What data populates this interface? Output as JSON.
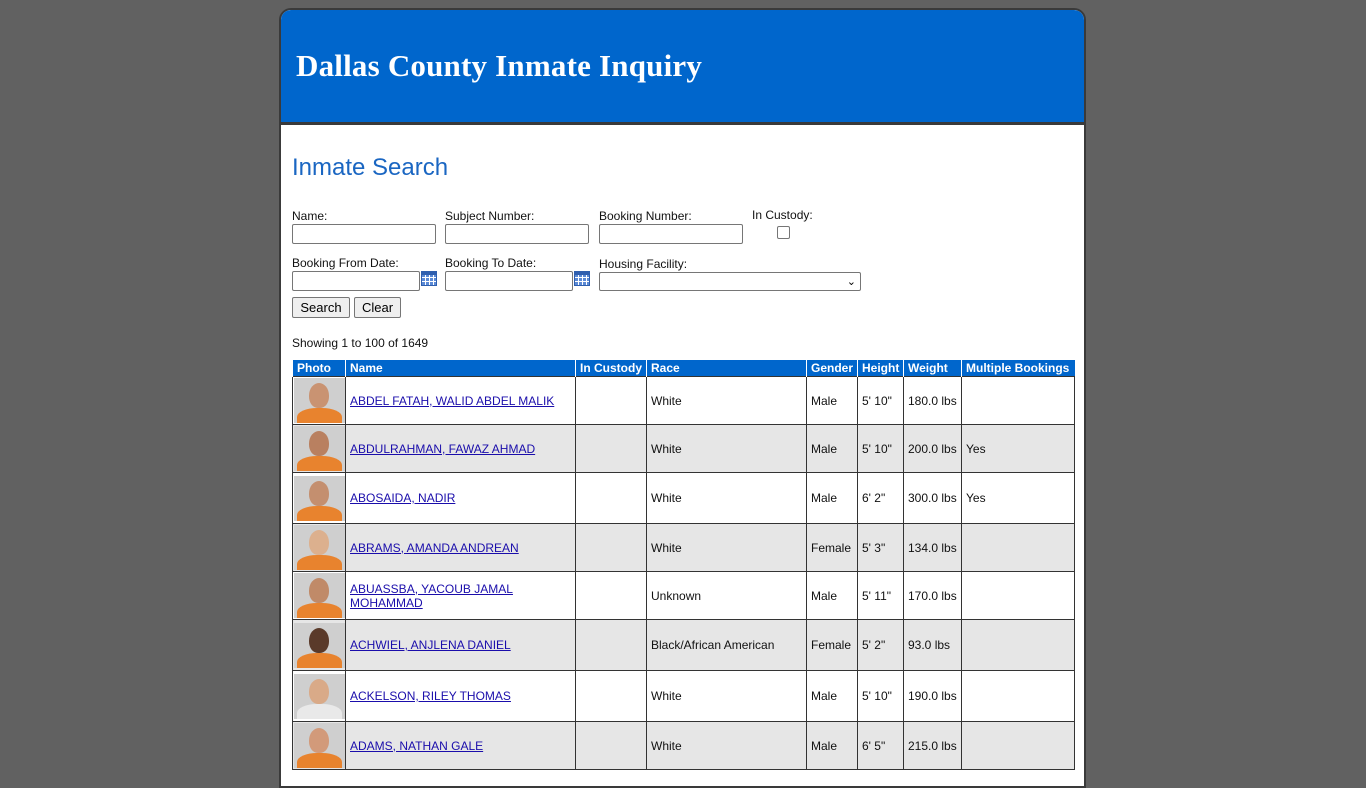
{
  "header": {
    "title": "Dallas County Inmate Inquiry"
  },
  "page": {
    "title": "Inmate Search"
  },
  "form": {
    "name_label": "Name:",
    "subject_label": "Subject Number:",
    "booking_label": "Booking Number:",
    "custody_label": "In Custody:",
    "from_label": "Booking From Date:",
    "to_label": "Booking To Date:",
    "facility_label": "Housing Facility:",
    "search_label": "Search",
    "clear_label": "Clear"
  },
  "results": {
    "summary": "Showing 1 to 100 of 1649",
    "columns": [
      "Photo",
      "Name",
      "In Custody",
      "Race",
      "Gender",
      "Height",
      "Weight",
      "Multiple Bookings"
    ],
    "rows": [
      {
        "name": "ABDEL FATAH, WALID ABDEL MALIK",
        "custody": "",
        "race": "White",
        "gender": "Male",
        "height": "5' 10\"",
        "weight": "180.0 lbs",
        "multiple": ""
      },
      {
        "name": "ABDULRAHMAN, FAWAZ AHMAD",
        "custody": "",
        "race": "White",
        "gender": "Male",
        "height": "5' 10\"",
        "weight": "200.0 lbs",
        "multiple": "Yes"
      },
      {
        "name": "ABOSAIDA, NADIR",
        "custody": "",
        "race": "White",
        "gender": "Male",
        "height": "6' 2\"",
        "weight": "300.0 lbs",
        "multiple": "Yes"
      },
      {
        "name": "ABRAMS, AMANDA ANDREAN",
        "custody": "",
        "race": "White",
        "gender": "Female",
        "height": "5' 3\"",
        "weight": "134.0 lbs",
        "multiple": ""
      },
      {
        "name": "ABUASSBA, YACOUB JAMAL MOHAMMAD",
        "custody": "",
        "race": "Unknown",
        "gender": "Male",
        "height": "5' 11\"",
        "weight": "170.0 lbs",
        "multiple": ""
      },
      {
        "name": "ACHWIEL, ANJLENA DANIEL",
        "custody": "",
        "race": "Black/African American",
        "gender": "Female",
        "height": "5' 2\"",
        "weight": "93.0 lbs",
        "multiple": ""
      },
      {
        "name": "ACKELSON, RILEY THOMAS",
        "custody": "",
        "race": "White",
        "gender": "Male",
        "height": "5' 10\"",
        "weight": "190.0 lbs",
        "multiple": ""
      },
      {
        "name": "ADAMS, NATHAN GALE",
        "custody": "",
        "race": "White",
        "gender": "Male",
        "height": "6' 5\"",
        "weight": "215.0 lbs",
        "multiple": ""
      }
    ]
  },
  "colors": {
    "header_bg": "#0066cc",
    "title_blue": "#1a66c2",
    "page_bg": "#616161",
    "alt_row": "#e6e6e6",
    "link": "#1a0dab"
  }
}
